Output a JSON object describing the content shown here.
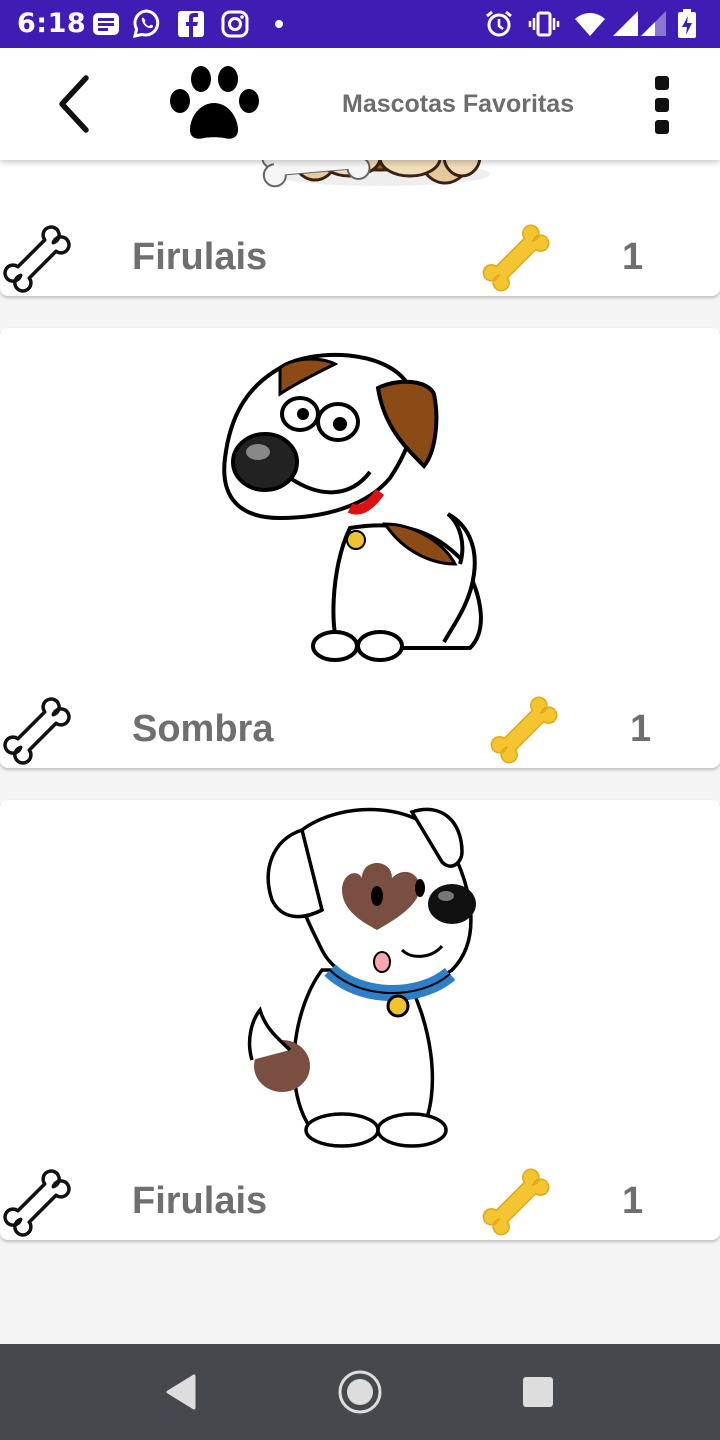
{
  "status_bar": {
    "time": "6:18",
    "left_icons": [
      "notes-icon",
      "whatsapp-icon",
      "facebook-icon",
      "instagram-icon",
      "dot-icon"
    ],
    "right_icons": [
      "alarm-icon",
      "vibrate-icon",
      "wifi-icon",
      "signal-icon",
      "signal-weak-icon",
      "battery-charging-icon"
    ]
  },
  "app_bar": {
    "title": "Mascotas Favoritas",
    "back_icon": "chevron-left-icon",
    "logo_icon": "paw-icon",
    "menu_icon": "overflow-menu-icon"
  },
  "pets": [
    {
      "name": "Firulais",
      "likes": "1",
      "image": "brown-puppy-with-bone"
    },
    {
      "name": "Sombra",
      "likes": "1",
      "image": "white-dog-brown-ears"
    },
    {
      "name": "Firulais",
      "likes": "1",
      "image": "white-dog-heart-spot"
    }
  ],
  "nav_bar": {
    "back": "nav-back-icon",
    "home": "nav-home-icon",
    "recents": "nav-recents-icon"
  },
  "colors": {
    "status_bar": "#3f1db5",
    "nav_bar": "#45484d",
    "gold_bone": "#f5c431",
    "text": "#6f6f6f"
  }
}
